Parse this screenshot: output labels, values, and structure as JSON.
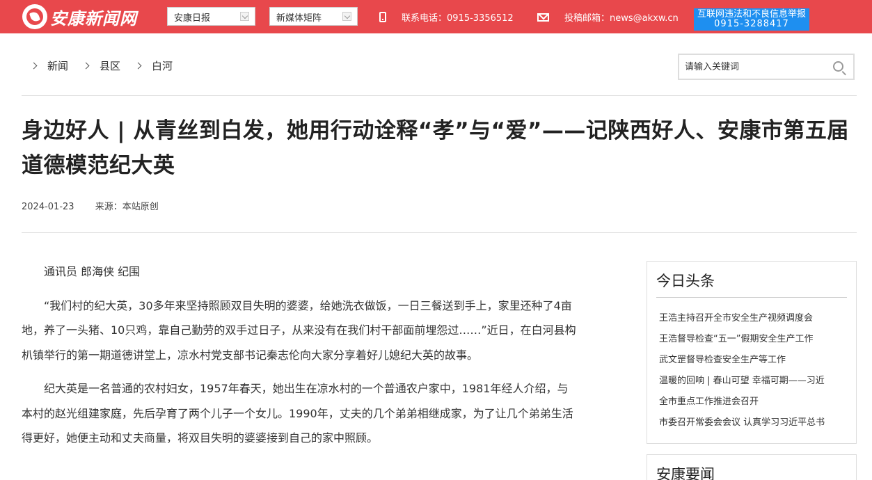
{
  "header": {
    "logo_text": "安康新闻网",
    "select1": "安康日报",
    "select2": "新媒体矩阵",
    "phone": "联系电话：0915-3356512",
    "email": "投稿邮箱：news@akxw.cn",
    "report_line1": "互联网违法和不良信息举报",
    "report_line2": "0915-3288417"
  },
  "breadcrumb": [
    "新闻",
    "县区",
    "白河"
  ],
  "search": {
    "placeholder": "请输入关键词"
  },
  "article": {
    "title": "身边好人 | 从青丝到白发，她用行动诠释“孝”与“爱”——记陕西好人、安康市第五届道德模范纪大英",
    "date": "2024-01-23",
    "source": "来源：本站原创",
    "paragraphs": [
      "通讯员 郎海侠 纪围",
      "“我们村的纪大英，30多年来坚持照顾双目失明的婆婆，给她洗衣做饭，一日三餐送到手上，家里还种了4亩地，养了一头猪、10只鸡，靠自己勤劳的双手过日子，从来没有在我们村干部面前埋怨过……”近日，在白河县构朳镇举行的第一期道德讲堂上，凉水村党支部书记秦志伦向大家分享着好儿媳纪大英的故事。",
      "纪大英是一名普通的农村妇女，1957年春天，她出生在凉水村的一个普通农户家中，1981年经人介绍，与本村的赵光组建家庭，先后孕育了两个儿子一个女儿。1990年，丈夫的几个弟弟相继成家，为了让几个弟弟生活得更好，她便主动和丈夫商量，将双目失明的婆婆接到自己的家中照顾。"
    ]
  },
  "sidebar": {
    "headlines_title": "今日头条",
    "headlines": [
      "王浩主持召开全市安全生产视频调度会",
      "王浩督导检查“五一”假期安全生产工作",
      "武文罡督导检查安全生产等工作",
      "温暖的回响 | 春山可望 幸福可期——习近",
      "全市重点工作推进会召开",
      "市委召开常委会会议 认真学习习近平总书"
    ],
    "news_title": "安康要闻"
  }
}
